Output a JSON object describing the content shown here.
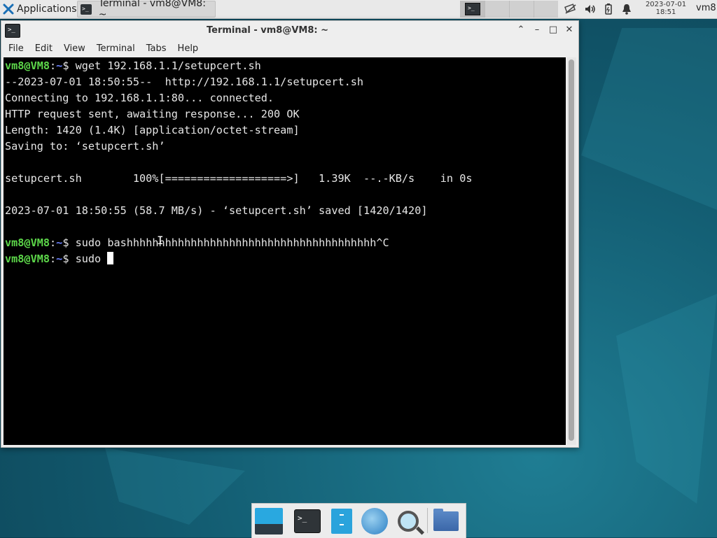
{
  "top_panel": {
    "applications_label": "Applications",
    "applications_sep": "⠿",
    "task_title": "Terminal - vm8@VM8: ~",
    "clock_date": "2023-07-01",
    "clock_time": "18:51",
    "user": "vm8"
  },
  "window": {
    "title": "Terminal - vm8@VM8: ~",
    "menu": [
      "File",
      "Edit",
      "View",
      "Terminal",
      "Tabs",
      "Help"
    ]
  },
  "terminal": {
    "prompt_user": "vm8@VM8",
    "prompt_sep": ":",
    "prompt_path": "~",
    "prompt_dollar": "$ ",
    "cmd1": "wget 192.168.1.1/setupcert.sh",
    "out1": "--2023-07-01 18:50:55--  http://192.168.1.1/setupcert.sh",
    "out2": "Connecting to 192.168.1.1:80... connected.",
    "out3": "HTTP request sent, awaiting response... 200 OK",
    "out4": "Length: 1420 (1.4K) [application/octet-stream]",
    "out5": "Saving to: ‘setupcert.sh’",
    "out6": "setupcert.sh        100%[===================>]   1.39K  --.-KB/s    in 0s",
    "out7": "2023-07-01 18:50:55 (58.7 MB/s) - ‘setupcert.sh’ saved [1420/1420]",
    "cmd2": "sudo bashhhhhhhhhhhhhhhhhhhhhhhhhhhhhhhhhhhhhhh^C",
    "cmd3": "sudo "
  },
  "dock": {
    "items": [
      "show-desktop",
      "terminal",
      "file-manager",
      "web-browser",
      "app-finder",
      "home-folder"
    ]
  }
}
